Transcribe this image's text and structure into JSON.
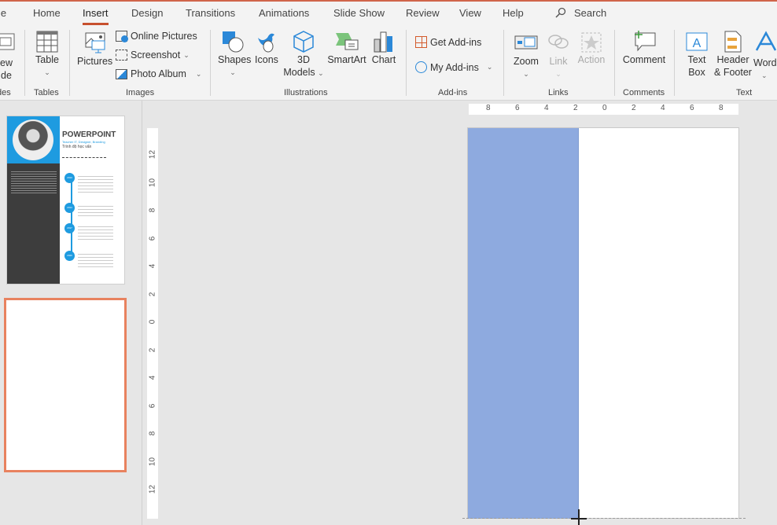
{
  "tabs": [
    "le",
    "Home",
    "Insert",
    "Design",
    "Transitions",
    "Animations",
    "Slide Show",
    "Review",
    "View",
    "Help"
  ],
  "active_tab": "Insert",
  "search_label": "Search",
  "ribbon": {
    "slides": {
      "btn": [
        "ew",
        "de"
      ],
      "group": "des"
    },
    "tables": {
      "btn": "Table",
      "group": "Tables"
    },
    "images": {
      "pictures": "Pictures",
      "online": "Online Pictures",
      "screenshot": "Screenshot",
      "album": "Photo Album",
      "group": "Images"
    },
    "illustrations": {
      "shapes": "Shapes",
      "icons": "Icons",
      "models": [
        "3D",
        "Models"
      ],
      "smartart": "SmartArt",
      "chart": "Chart",
      "group": "Illustrations"
    },
    "addins": {
      "get": "Get Add-ins",
      "my": "My Add-ins",
      "group": "Add-ins"
    },
    "links": {
      "zoom": "Zoom",
      "link": "Link",
      "action": "Action",
      "group": "Links"
    },
    "comments": {
      "comment": "Comment",
      "group": "Comments"
    },
    "text": {
      "textbox": [
        "Text",
        "Box"
      ],
      "header": [
        "Header",
        "& Footer"
      ],
      "word": "Word",
      "group": "Text"
    }
  },
  "thumbnail1": {
    "title": "POWERPOINT",
    "subtitle": "Teacher IT, Designer, Branding",
    "edu": "Trình độ học vấn",
    "years": [
      "2013",
      "2014",
      "2017",
      "2020"
    ]
  },
  "hruler_labels": [
    "8",
    "6",
    "4",
    "2",
    "0",
    "2",
    "4",
    "6",
    "8"
  ],
  "vruler_labels": [
    "12",
    "10",
    "8",
    "6",
    "4",
    "2",
    "0",
    "2",
    "4",
    "6",
    "8",
    "10",
    "12"
  ],
  "colors": {
    "accent": "#c7502e",
    "shape_fill": "#8eaadf",
    "selected_slide_border": "#e8825f",
    "resume_blue": "#1e9be0",
    "resume_dark": "#3d3d3d"
  }
}
